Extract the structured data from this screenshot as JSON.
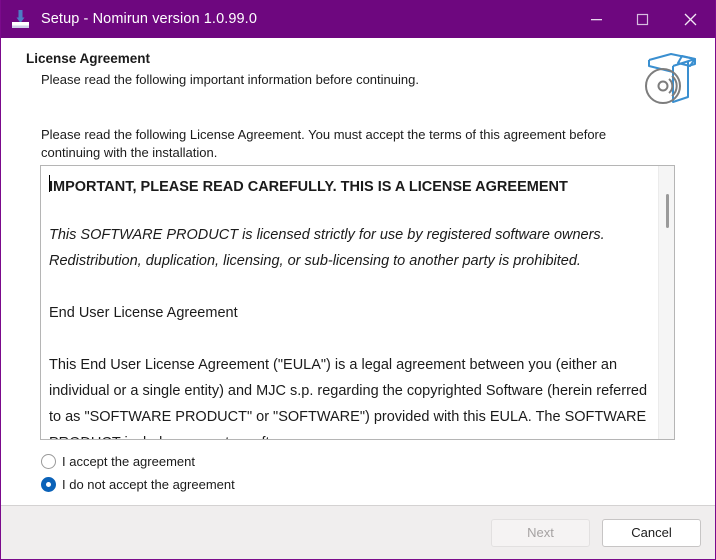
{
  "window": {
    "title": "Setup - Nomirun version 1.0.99.0",
    "app_icon": "installer-download-tray-icon",
    "accent_color": "#6E077F",
    "controls": {
      "minimize_label": "minimize-icon",
      "maximize_label": "maximize-icon",
      "close_label": "close-icon"
    }
  },
  "header": {
    "title": "License Agreement",
    "subtitle": "Please read the following important information before continuing.",
    "icon": "software-box-with-disc-icon"
  },
  "intro": {
    "text": "Please read the following License Agreement. You must accept the terms of this agreement before continuing with the installation."
  },
  "license": {
    "paragraphs": [
      "IMPORTANT, PLEASE READ CAREFULLY. THIS IS A LICENSE AGREEMENT",
      "This SOFTWARE PRODUCT is licensed strictly for use by registered software owners. Redistribution, duplication, licensing, or sub-licensing to another party is prohibited.",
      "End User License Agreement",
      "This End User License Agreement (\"EULA\") is a legal agreement between you (either an individual or a single entity) and MJC s.p. regarding the copyrighted Software (herein referred to as \"SOFTWARE PRODUCT\" or \"SOFTWARE\") provided with this EULA. The SOFTWARE PRODUCT includes computer software"
    ],
    "scrollbar": "vertical-scrollbar"
  },
  "options": {
    "accept_label": "I accept the agreement",
    "decline_label": "I do not accept the agreement",
    "selected": "decline",
    "selected_color": "#0B62B8"
  },
  "footer": {
    "next_label": "Next",
    "next_enabled": false,
    "cancel_label": "Cancel",
    "cancel_enabled": true
  }
}
